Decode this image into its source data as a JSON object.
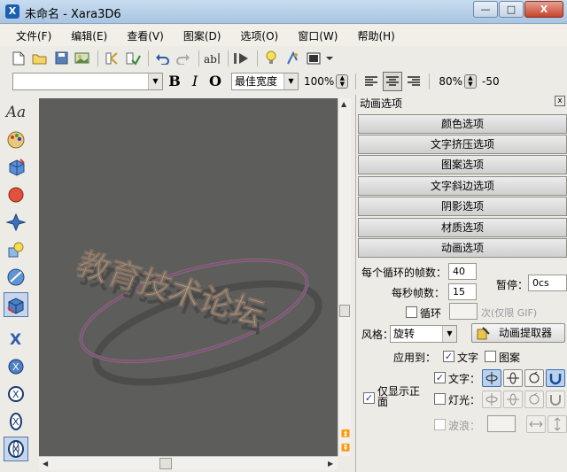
{
  "window": {
    "title": "未命名 - Xara3D6",
    "app_icon_glyph": "X",
    "min_glyph": "—",
    "max_glyph": "□",
    "close_glyph": "X"
  },
  "menu": [
    "文件(F)",
    "编辑(E)",
    "查看(V)",
    "图案(D)",
    "选项(O)",
    "窗口(W)",
    "帮助(H)"
  ],
  "toolbar2": {
    "font_value": "",
    "bold": "B",
    "italic": "I",
    "outline": "O",
    "width_mode": "最佳宽度",
    "zoom": "100%",
    "line_spacing": "80%",
    "letter_spacing": "-50"
  },
  "panel": {
    "title": "动画选项",
    "close": "x",
    "sections": [
      "颜色选项",
      "文字挤压选项",
      "图案选项",
      "文字斜边选项",
      "阴影选项",
      "材质选项",
      "动画选项"
    ],
    "loop_frames_label": "每个循环的帧数：",
    "loop_frames_value": "40",
    "fps_label": "每秒帧数：",
    "fps_value": "15",
    "pause_label": "暂停：",
    "pause_value": "0cs",
    "loop_label": "循环",
    "loop_frames_hint": "次(仅限 GIF)",
    "style_label": "风格：",
    "style_value": "旋转",
    "extractor_label": "动画提取器",
    "apply_to_label": "应用到：",
    "apply_text_label": "文字",
    "apply_pattern_label": "图案",
    "text_label": "文字：",
    "light_label": "灯光：",
    "wave_label": "波浪：",
    "front_only_label": "仅显示正面"
  },
  "canvas": {
    "text_art": "教育技术论坛",
    "background": "#5d5d5c"
  }
}
